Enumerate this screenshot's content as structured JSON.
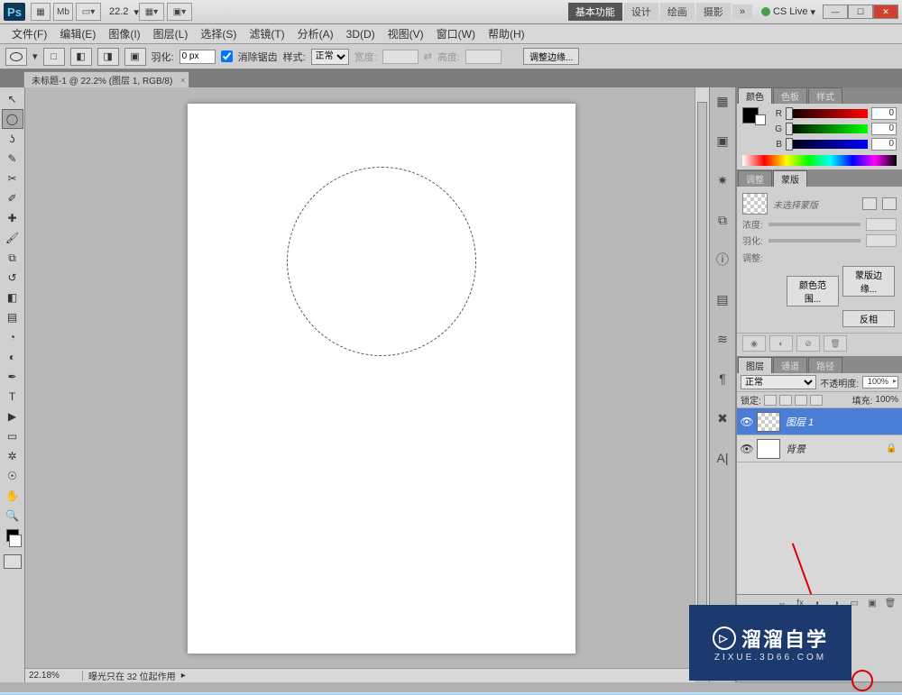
{
  "titlebar": {
    "logo": "Ps",
    "zoom_label": "22.2",
    "workspace_primary": "基本功能",
    "ws_design": "设计",
    "ws_paint": "绘画",
    "ws_photo": "摄影",
    "ws_more": "»",
    "cslive": "CS Live"
  },
  "menu": [
    "文件(F)",
    "编辑(E)",
    "图像(I)",
    "图层(L)",
    "选择(S)",
    "滤镜(T)",
    "分析(A)",
    "3D(D)",
    "视图(V)",
    "窗口(W)",
    "帮助(H)"
  ],
  "options": {
    "feather_label": "羽化:",
    "feather_value": "0 px",
    "antialias": "消除锯齿",
    "style_label": "样式:",
    "style_value": "正常",
    "width_label": "宽度:",
    "height_label": "高度:",
    "refine_edge": "调整边缘..."
  },
  "doc_tab": "未标题-1 @ 22.2% (图层 1, RGB/8)",
  "statusbar": {
    "zoom": "22.18%",
    "info": "曝光只在 32 位起作用"
  },
  "color_panel": {
    "tabs": [
      "颜色",
      "色板",
      "样式"
    ],
    "r_label": "R",
    "g_label": "G",
    "b_label": "B",
    "r": "0",
    "g": "0",
    "b": "0"
  },
  "mask_panel": {
    "tabs": [
      "调整",
      "蒙版"
    ],
    "no_mask": "未选择蒙版",
    "density": "浓度:",
    "feather": "羽化:",
    "adjust": "调整:",
    "btn_edge": "蒙版边缘...",
    "btn_range": "颜色范围...",
    "btn_invert": "反相"
  },
  "layers_panel": {
    "tabs": [
      "图层",
      "通道",
      "路径"
    ],
    "blend": "正常",
    "opacity_label": "不透明度:",
    "opacity": "100%",
    "lock_label": "锁定:",
    "fill_label": "填充:",
    "fill": "100%",
    "layers": [
      {
        "name": "图层 1",
        "selected": true,
        "locked": false
      },
      {
        "name": "背景",
        "selected": false,
        "locked": true
      }
    ]
  },
  "watermark": {
    "main": "溜溜自学",
    "sub": "ZIXUE.3D66.COM"
  }
}
